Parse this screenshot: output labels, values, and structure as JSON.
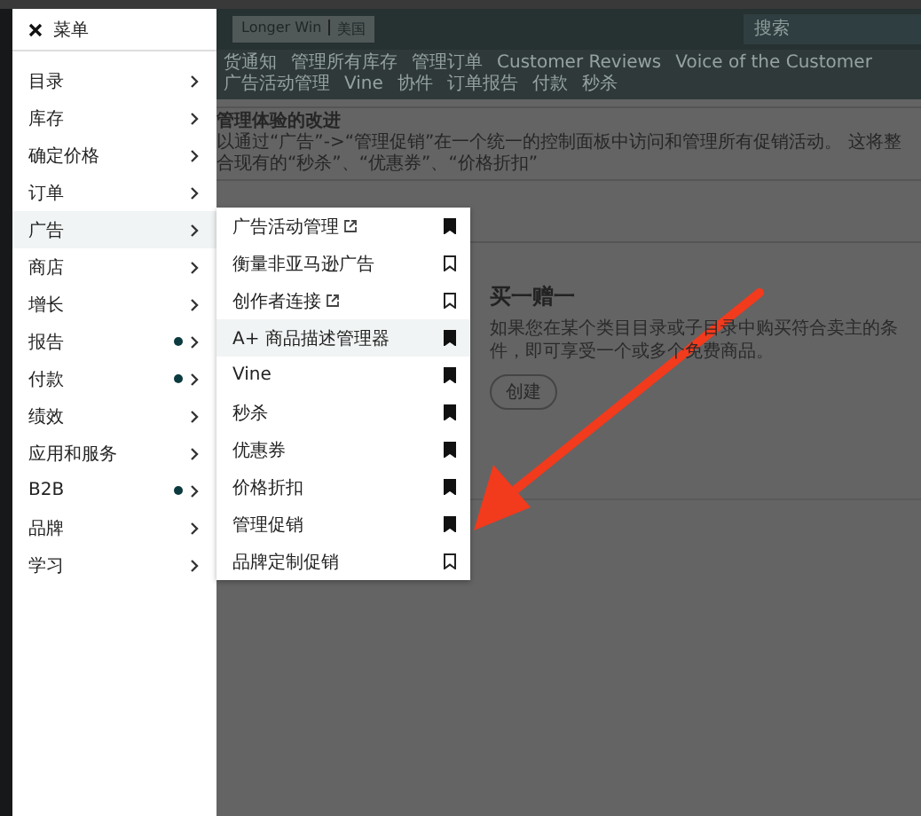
{
  "top_bar": {
    "store_label": "Longer Win",
    "region": "美国",
    "search": {
      "placeholder": "搜索"
    }
  },
  "nav": [
    "货通知",
    "管理所有库存",
    "管理订单",
    "Customer Reviews",
    "Voice of the Customer",
    "广告活动管理",
    "Vine",
    "协件",
    "订单报告",
    "付款",
    "秒杀"
  ],
  "banner": {
    "title": "管理体验的改进",
    "text": "以通过“广告”->“管理促销”在一个统一的控制面板中访问和管理所有促销活动。 这将整合现有的“秒杀”、“优惠券”、“价格折扣”"
  },
  "promo": {
    "title": "买一赠一",
    "text": "如果您在某个类目目录或子目录中购买符合卖主的条件，即可享受一个或多个免费商品。",
    "button": "创建"
  },
  "menu": {
    "title": "菜单",
    "items": [
      {
        "label": "目录",
        "selected": false,
        "notification": false
      },
      {
        "label": "库存",
        "selected": false,
        "notification": false
      },
      {
        "label": "确定价格",
        "selected": false,
        "notification": false
      },
      {
        "label": "订单",
        "selected": false,
        "notification": false
      },
      {
        "label": "广告",
        "selected": true,
        "notification": false
      },
      {
        "label": "商店",
        "selected": false,
        "notification": false
      },
      {
        "label": "增长",
        "selected": false,
        "notification": false
      },
      {
        "label": "报告",
        "selected": false,
        "notification": true
      },
      {
        "label": "付款",
        "selected": false,
        "notification": true
      },
      {
        "label": "绩效",
        "selected": false,
        "notification": false
      },
      {
        "label": "应用和服务",
        "selected": false,
        "notification": false
      },
      {
        "label": "B2B",
        "selected": false,
        "notification": true
      },
      {
        "label": "品牌",
        "selected": false,
        "notification": false
      },
      {
        "label": "学习",
        "selected": false,
        "notification": false
      }
    ]
  },
  "submenu": {
    "items": [
      {
        "label": "广告活动管理",
        "external": true,
        "selected": false,
        "bookmarked": true
      },
      {
        "label": "衡量非亚马逊广告",
        "external": false,
        "selected": false,
        "bookmarked": false
      },
      {
        "label": "创作者连接",
        "external": true,
        "selected": false,
        "bookmarked": false
      },
      {
        "label": "A+ 商品描述管理器",
        "external": false,
        "selected": true,
        "bookmarked": true
      },
      {
        "label": "Vine",
        "external": false,
        "selected": false,
        "bookmarked": true
      },
      {
        "label": "秒杀",
        "external": false,
        "selected": false,
        "bookmarked": true
      },
      {
        "label": "优惠券",
        "external": false,
        "selected": false,
        "bookmarked": true
      },
      {
        "label": "价格折扣",
        "external": false,
        "selected": false,
        "bookmarked": true
      },
      {
        "label": "管理促销",
        "external": false,
        "selected": false,
        "bookmarked": true
      },
      {
        "label": "品牌定制促销",
        "external": false,
        "selected": false,
        "bookmarked": false
      }
    ]
  }
}
